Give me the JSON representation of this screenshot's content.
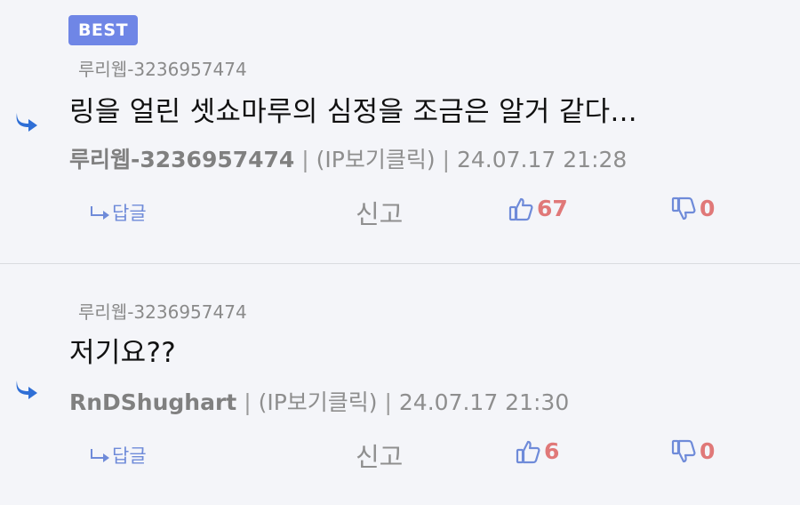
{
  "comments": [
    {
      "badge": "BEST",
      "reply_to": "루리웹-3236957474",
      "text": "링을 얼린 셋쇼마루의 심정을 조금은 알거 같다...",
      "author": "루리웹-3236957474",
      "ip_link": "(IP보기클릭)",
      "timestamp": "24.07.17 21:28",
      "reply_label": "답글",
      "report_label": "신고",
      "likes": "67",
      "dislikes": "0"
    },
    {
      "reply_to": "루리웹-3236957474",
      "text": "저기요??",
      "author": "RnDShughart",
      "ip_link": "(IP보기클릭)",
      "timestamp": "24.07.17 21:30",
      "reply_label": "답글",
      "report_label": "신고",
      "likes": "6",
      "dislikes": "0"
    }
  ],
  "separator": "|",
  "icons": {
    "reply_arrow": "reply-arrow-icon",
    "like": "thumbs-up-icon",
    "dislike": "thumbs-down-icon"
  },
  "colors": {
    "badge": "#6f86e6",
    "reply_arrow": "#2f6fd6",
    "count": "#e07878",
    "link": "#6f8bd9"
  }
}
